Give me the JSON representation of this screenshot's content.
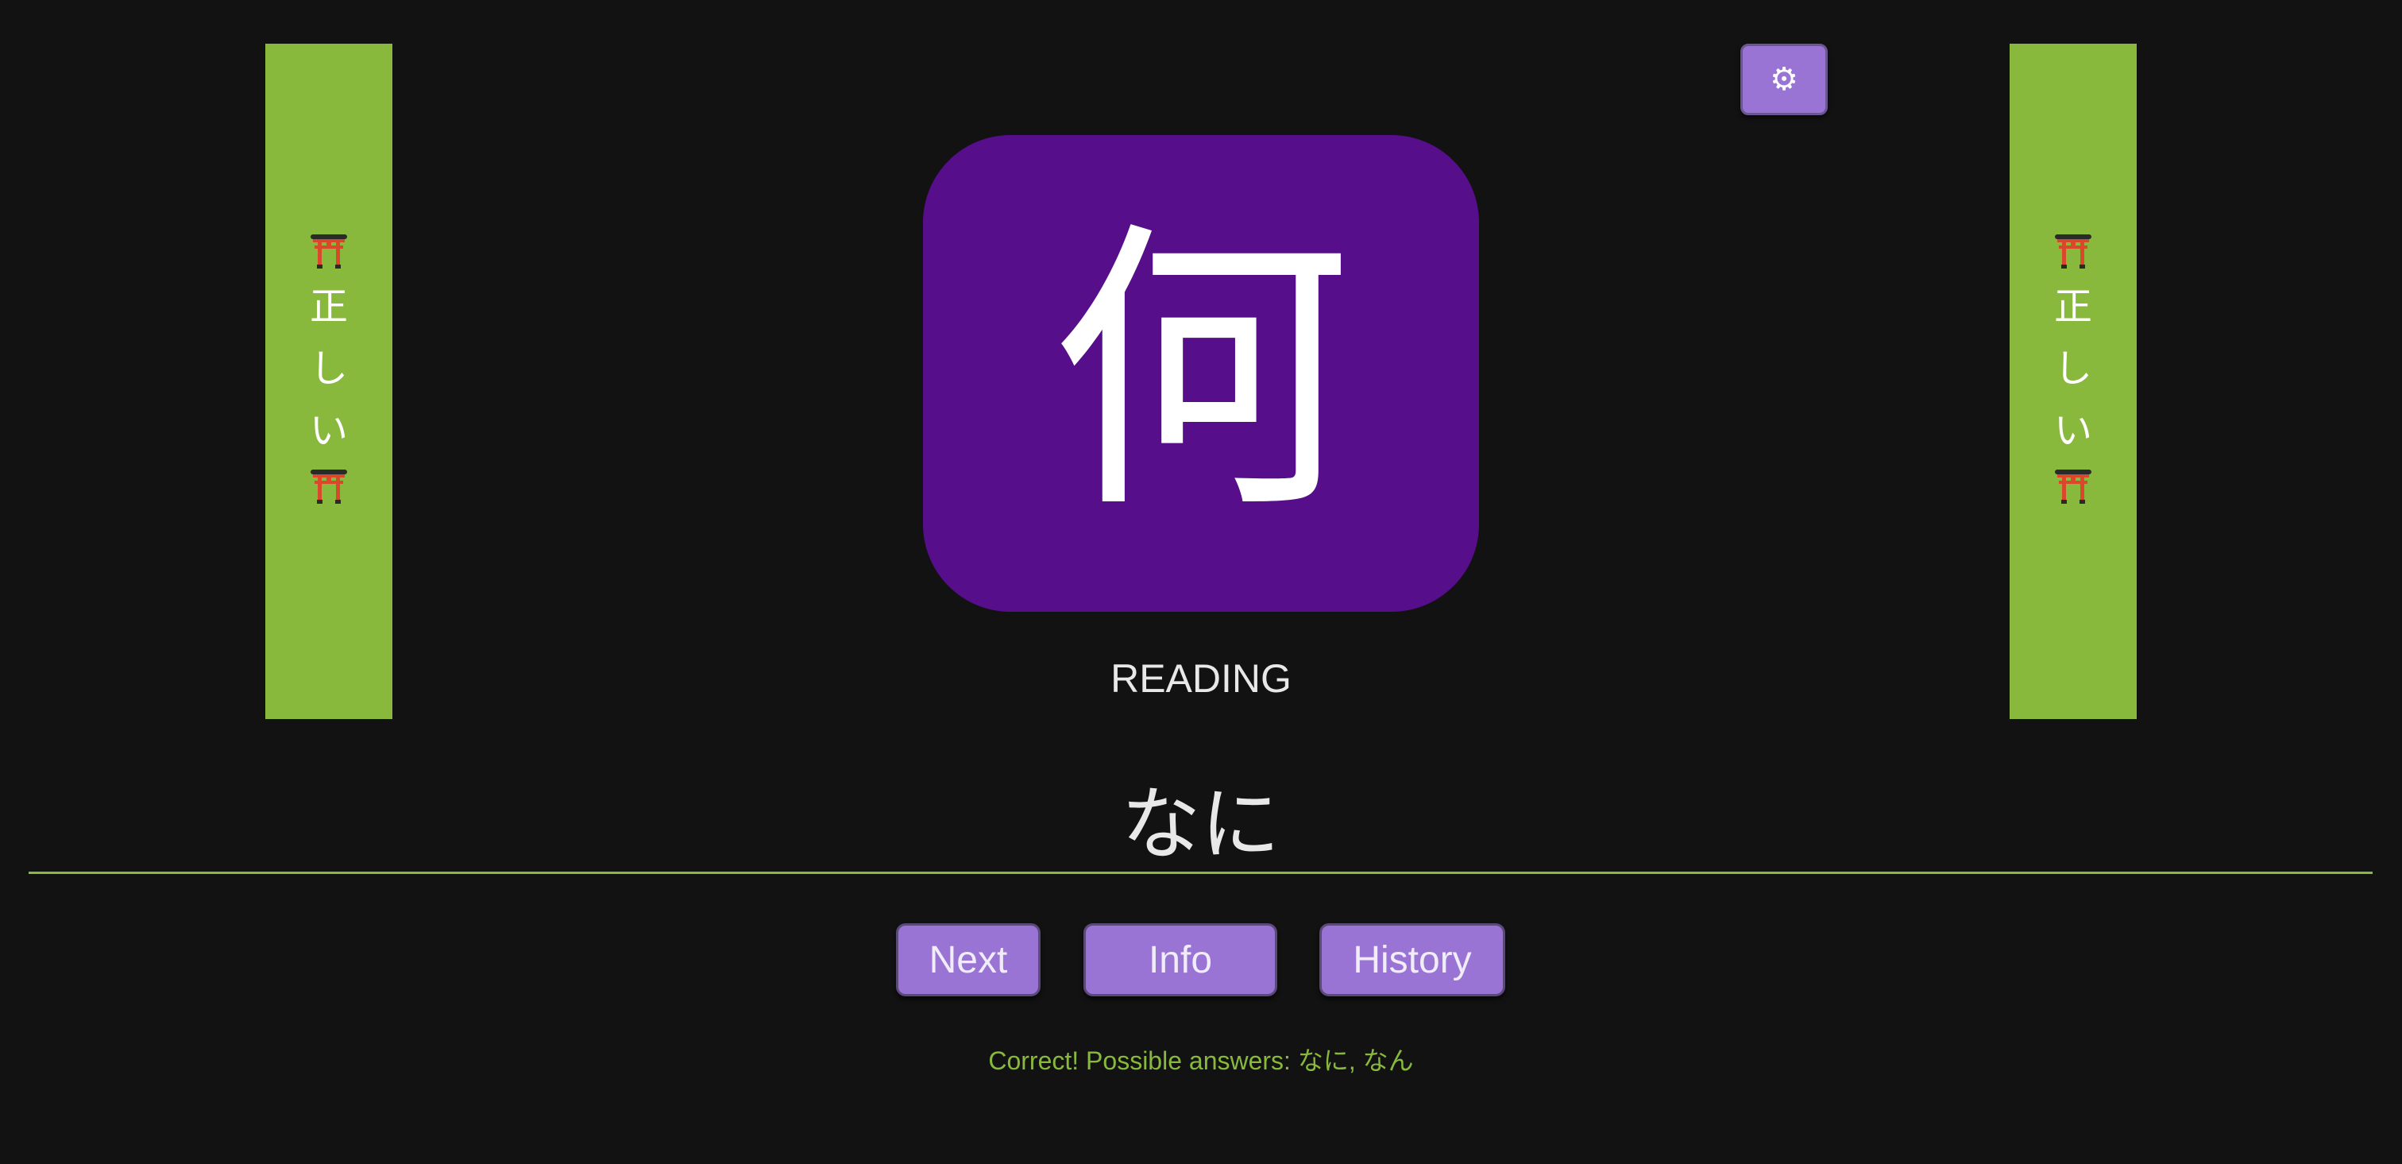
{
  "banner": {
    "top_icon": "torii-gate-icon",
    "bottom_icon": "torii-gate-icon",
    "chars": [
      "正",
      "し",
      "い"
    ]
  },
  "settings": {
    "icon": "gear-icon",
    "glyph": "⚙"
  },
  "card": {
    "kanji": "何"
  },
  "mode_label": "READING",
  "answer": {
    "value": "なに"
  },
  "buttons": {
    "next": "Next",
    "info": "Info",
    "history": "History"
  },
  "feedback": "Correct! Possible answers: なに, なん",
  "colors": {
    "background": "#121212",
    "banner": "#88b83c",
    "card": "#560e8a",
    "button": "#9a74d4",
    "feedback": "#88b83c"
  }
}
